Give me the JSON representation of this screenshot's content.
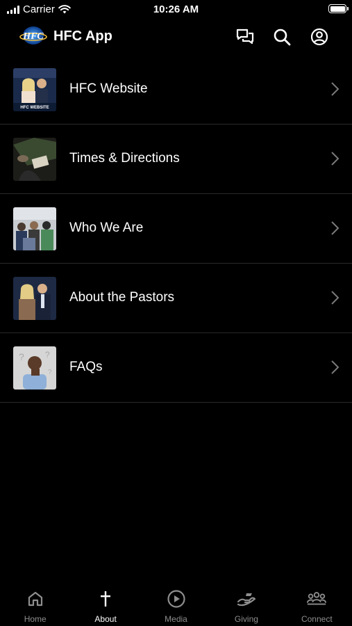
{
  "status_bar": {
    "carrier": "Carrier",
    "time": "10:26 AM"
  },
  "header": {
    "title": "HFC App",
    "logo_text": "HFC",
    "icons": [
      "chat-icon",
      "search-icon",
      "profile-icon"
    ]
  },
  "menu": {
    "items": [
      {
        "label": "HFC Website",
        "thumb_caption": "HFC WEBSITE",
        "thumb_subject": "couple-photo"
      },
      {
        "label": "Times & Directions",
        "thumb_subject": "bible-notes-photo"
      },
      {
        "label": "Who We Are",
        "thumb_subject": "crowd-photo"
      },
      {
        "label": "About the Pastors",
        "thumb_subject": "pastors-photo"
      },
      {
        "label": "FAQs",
        "thumb_subject": "thinking-man-photo"
      }
    ]
  },
  "tabs": [
    {
      "label": "Home",
      "icon": "home-icon",
      "active": false
    },
    {
      "label": "About",
      "icon": "cross-icon",
      "active": true
    },
    {
      "label": "Media",
      "icon": "play-icon",
      "active": false
    },
    {
      "label": "Giving",
      "icon": "giving-hand-icon",
      "active": false
    },
    {
      "label": "Connect",
      "icon": "group-icon",
      "active": false
    }
  ],
  "colors": {
    "background": "#000000",
    "text": "#ffffff",
    "inactive_tab": "#8e8e8e",
    "divider": "#2a2a2a"
  }
}
